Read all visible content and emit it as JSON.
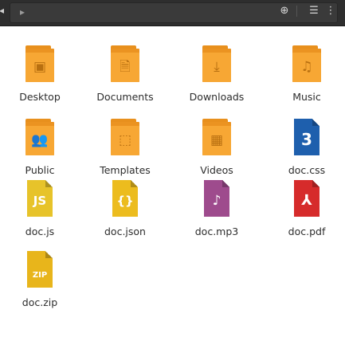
{
  "colors": {
    "toolbar_bg": "#2e2e2e",
    "folder": "#f7a734",
    "folder_symbol": "#b86f10",
    "css": "#1e5fad",
    "js": "#e7c32a",
    "json": "#ecbc1e",
    "mp3": "#9e4b8d",
    "pdf": "#d62b2b",
    "zip": "#e8b51b",
    "label": "#2d2d2d"
  },
  "items": [
    {
      "name": "Desktop",
      "kind": "folder",
      "icon": "desktop-icon",
      "glyph": "▣"
    },
    {
      "name": "Documents",
      "kind": "folder",
      "icon": "document-icon",
      "glyph": "🗎"
    },
    {
      "name": "Downloads",
      "kind": "folder",
      "icon": "download-icon",
      "glyph": "⤓"
    },
    {
      "name": "Music",
      "kind": "folder",
      "icon": "music-note-icon",
      "glyph": "♫"
    },
    {
      "name": "Public",
      "kind": "folder",
      "icon": "people-icon",
      "glyph": "👥"
    },
    {
      "name": "Templates",
      "kind": "folder",
      "icon": "template-icon",
      "glyph": "⬚"
    },
    {
      "name": "Videos",
      "kind": "folder",
      "icon": "film-icon",
      "glyph": "▦"
    },
    {
      "name": "doc.css",
      "kind": "file",
      "icon": "css-file-icon",
      "symbol": "3"
    },
    {
      "name": "doc.js",
      "kind": "file",
      "icon": "js-file-icon",
      "symbol": "JS"
    },
    {
      "name": "doc.json",
      "kind": "file",
      "icon": "json-file-icon",
      "symbol": "{}"
    },
    {
      "name": "doc.mp3",
      "kind": "file",
      "icon": "audio-file-icon",
      "symbol": "♪"
    },
    {
      "name": "doc.pdf",
      "kind": "file",
      "icon": "pdf-file-icon",
      "symbol": "⅄"
    },
    {
      "name": "doc.zip",
      "kind": "file",
      "icon": "zip-file-icon",
      "symbol": "ZIP"
    }
  ],
  "toolbar": {
    "back_glyph": "◂",
    "forward_glyph": "▸",
    "locate_glyph": "⊕",
    "view_glyph": "☰",
    "more_glyph": "⋮"
  }
}
